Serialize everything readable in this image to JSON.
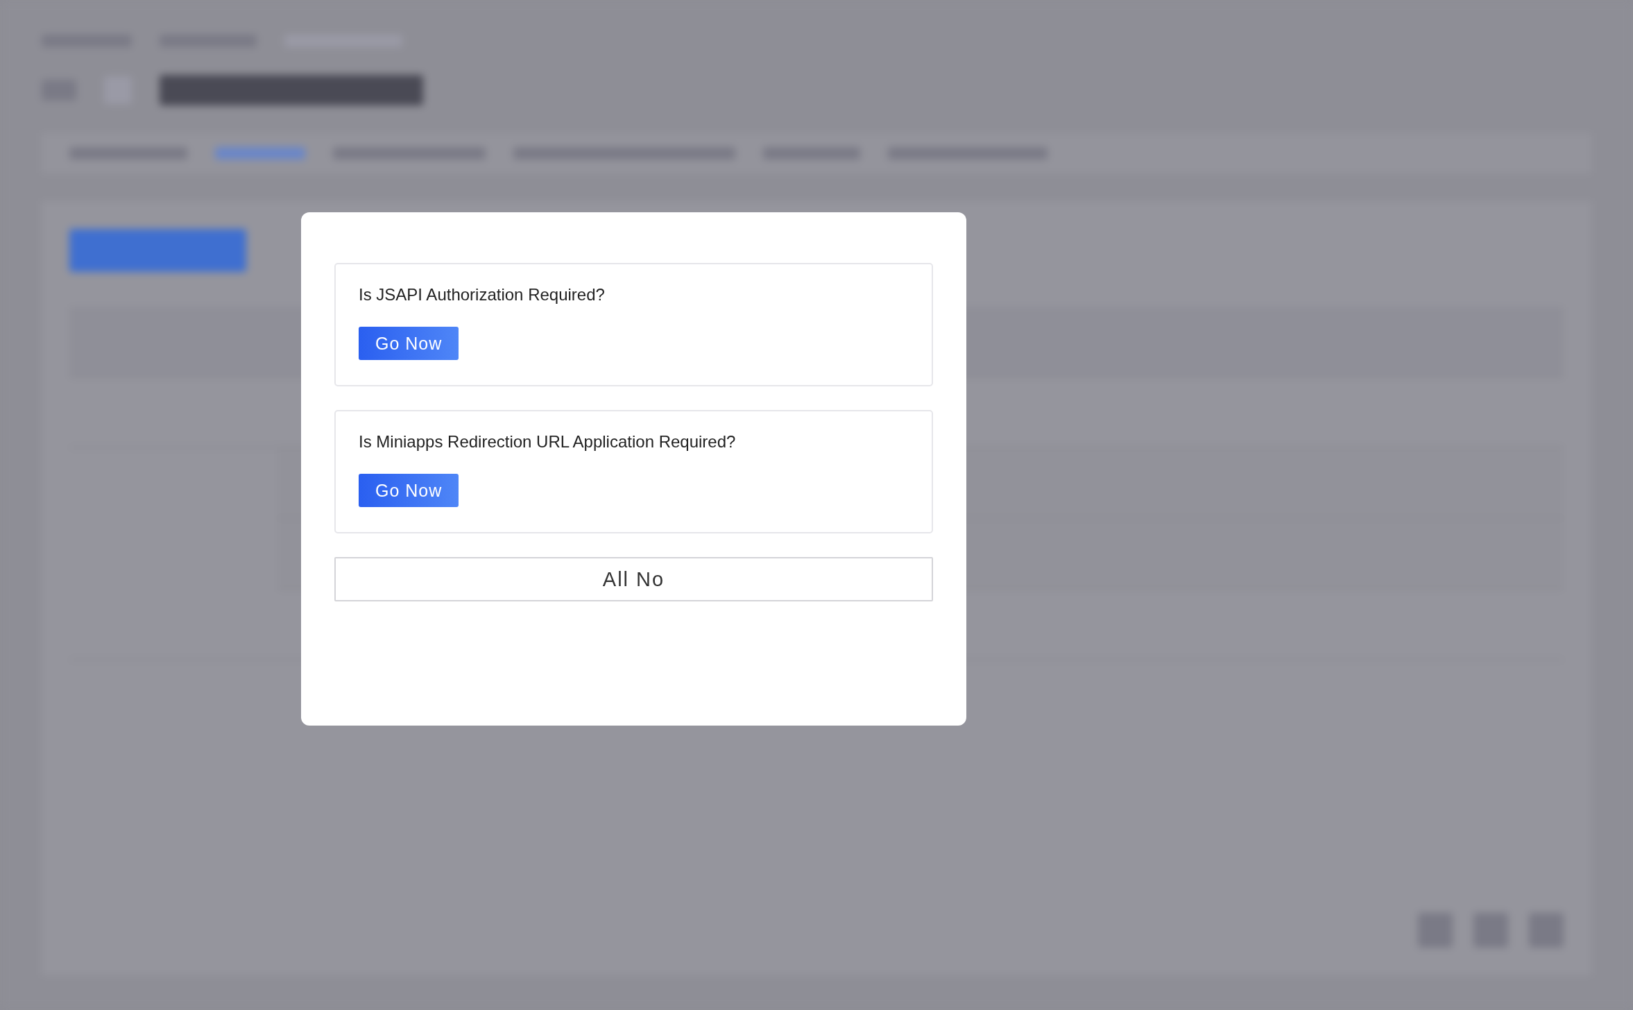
{
  "dialog": {
    "questions": [
      {
        "text": "Is JSAPI Authorization Required?",
        "button": "Go Now"
      },
      {
        "text": "Is Miniapps Redirection URL Application Required?",
        "button": "Go Now"
      }
    ],
    "all_no_button": "All No"
  }
}
